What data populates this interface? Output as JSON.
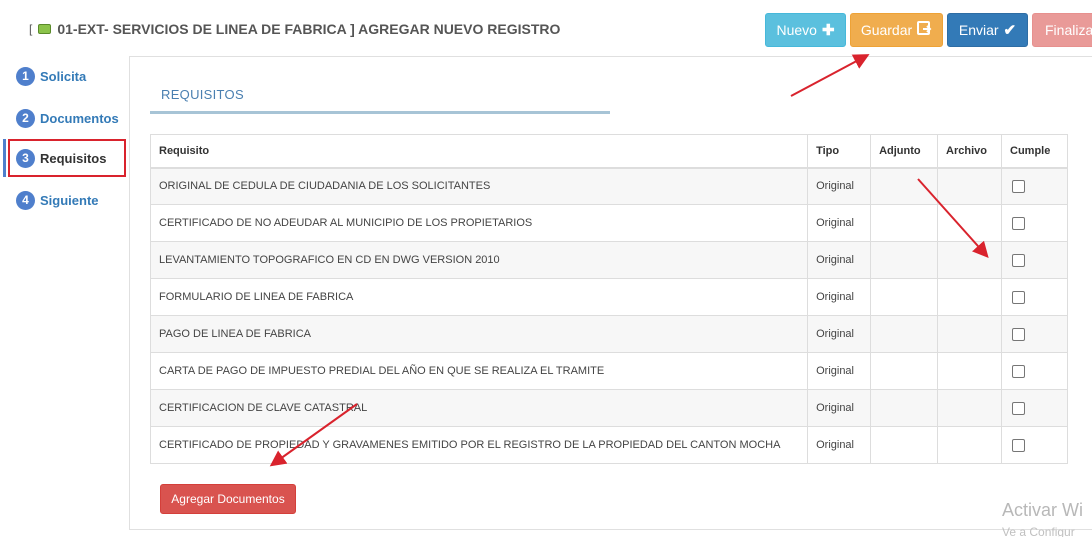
{
  "header": {
    "bracket_open": "[",
    "title": "01-EXT- SERVICIOS DE LINEA DE FABRICA ] AGREGAR NUEVO REGISTRO"
  },
  "toolbar": {
    "nuevo": "Nuevo",
    "guardar": "Guardar",
    "enviar": "Enviar",
    "finalizar": "Finaliza"
  },
  "sidebar": {
    "items": [
      {
        "num": "1",
        "label": "Solicita"
      },
      {
        "num": "2",
        "label": "Documentos"
      },
      {
        "num": "3",
        "label": "Requisitos"
      },
      {
        "num": "4",
        "label": "Siguiente"
      }
    ]
  },
  "section": {
    "title": "REQUISITOS"
  },
  "table": {
    "headers": [
      "Requisito",
      "Tipo",
      "Adjunto",
      "Archivo",
      "Cumple"
    ],
    "rows": [
      {
        "requisito": "ORIGINAL DE CEDULA DE CIUDADANIA DE LOS SOLICITANTES",
        "tipo": "Original"
      },
      {
        "requisito": "CERTIFICADO DE NO ADEUDAR AL MUNICIPIO DE LOS PROPIETARIOS",
        "tipo": "Original"
      },
      {
        "requisito": "LEVANTAMIENTO TOPOGRAFICO EN CD EN DWG VERSION 2010",
        "tipo": "Original"
      },
      {
        "requisito": "FORMULARIO DE LINEA DE FABRICA",
        "tipo": "Original"
      },
      {
        "requisito": "PAGO DE LINEA DE FABRICA",
        "tipo": "Original"
      },
      {
        "requisito": "CARTA DE PAGO DE IMPUESTO PREDIAL DEL AÑO EN QUE SE REALIZA EL TRAMITE",
        "tipo": "Original"
      },
      {
        "requisito": "CERTIFICACION DE CLAVE CATASTRAL",
        "tipo": "Original"
      },
      {
        "requisito": "CERTIFICADO DE PROPIEDAD Y GRAVAMENES EMITIDO POR EL REGISTRO DE LA PROPIEDAD DEL CANTON MOCHA",
        "tipo": "Original"
      }
    ]
  },
  "actions": {
    "agregar": "Agregar Documentos"
  },
  "watermark": {
    "line1": "Activar Wi",
    "line2": "Ve a Configur"
  },
  "colors": {
    "annotation_red": "#d9232d",
    "accent_blue": "#337ab7"
  }
}
